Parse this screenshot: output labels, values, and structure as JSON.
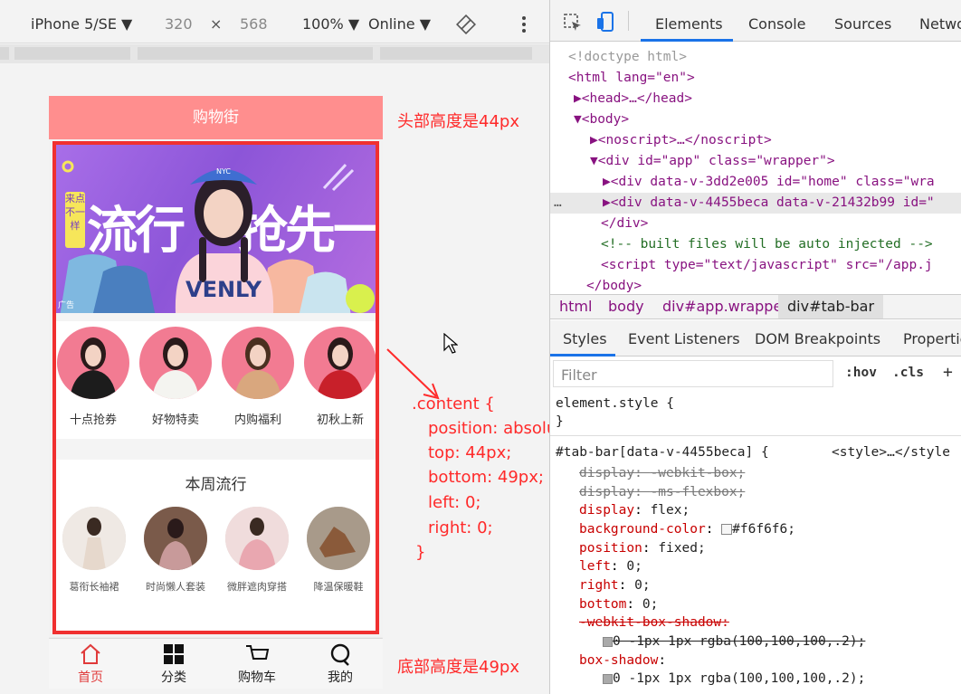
{
  "device_toolbar": {
    "device": "iPhone 5/SE ▼",
    "width": "320",
    "times": "×",
    "height": "568",
    "zoom": "100% ▼",
    "network": "Online ▼"
  },
  "phone": {
    "header_title": "购物街",
    "banner": {
      "tag": "来点不一样",
      "text_left": "流行",
      "text_right": "抢先一步",
      "ad_label": "广告",
      "cap_text": "NYC",
      "shirt_text": "VENLY"
    },
    "hot_items": [
      "十点抢券",
      "好物特卖",
      "内购福利",
      "初秋上新"
    ],
    "weekly_title": "本周流行",
    "weekly_items": [
      "葛衔长袖裙",
      "时尚懒人套装",
      "微胖遮肉穿搭",
      "降温保暖鞋"
    ],
    "tabs": [
      {
        "label": "首页",
        "active": true
      },
      {
        "label": "分类",
        "active": false
      },
      {
        "label": "购物车",
        "active": false
      },
      {
        "label": "我的",
        "active": false
      }
    ]
  },
  "annotations": {
    "header_note": "头部高度是44px",
    "css_lines": [
      ".content {",
      "position: absolute;",
      "top: 44px;",
      "bottom: 49px;",
      "left: 0;",
      "right: 0;",
      "}"
    ],
    "footer_note": "底部高度是49px"
  },
  "devtools": {
    "tabs": [
      "Elements",
      "Console",
      "Sources",
      "Netwo"
    ],
    "html_lines": [
      "<!doctype html>",
      "<html lang=\"en\">",
      "▶<head>…</head>",
      "▼<body>",
      "▶<noscript>…</noscript>",
      "▼<div id=\"app\" class=\"wrapper\">",
      "▶<div data-v-3dd2e005 id=\"home\" class=\"wra",
      "▶<div data-v-4455beca data-v-21432b99 id=\"",
      "</div>",
      "<!-- built files will be auto injected -->",
      "<script type=\"text/javascript\" src=\"/app.j",
      "</body>"
    ],
    "breadcrumbs": [
      "html",
      "body",
      "div#app.wrapper",
      "div#tab-bar"
    ],
    "style_tabs": [
      "Styles",
      "Event Listeners",
      "DOM Breakpoints",
      "Propertie"
    ],
    "filter_placeholder": "Filter",
    "filter_hov": ":hov",
    "filter_cls": ".cls",
    "filter_plus": "+",
    "element_style": "element.style {",
    "element_style_close": "}",
    "rule_selector": "#tab-bar[data-v-4455beca] {",
    "rule_source": "<style>…</style",
    "declarations": [
      {
        "prop": "display",
        "value": "-webkit-box;",
        "struck": true
      },
      {
        "prop": "display",
        "value": "-ms-flexbox;",
        "struck": true
      },
      {
        "prop": "display",
        "value": "flex;",
        "struck": false
      },
      {
        "prop": "background-color",
        "value": "#f6f6f6;",
        "struck": false
      },
      {
        "prop": "position",
        "value": "fixed;",
        "struck": false
      },
      {
        "prop": "left",
        "value": "0;",
        "struck": false
      },
      {
        "prop": "right",
        "value": "0;",
        "struck": false
      },
      {
        "prop": "bottom",
        "value": "0;",
        "struck": false
      },
      {
        "prop": "-webkit-box-shadow",
        "value": "",
        "struck": true
      },
      {
        "prop": "",
        "value": "0 -1px 1px rgba(100,100,100,.2);",
        "struck": true
      },
      {
        "prop": "box-shadow",
        "value": "",
        "struck": false
      },
      {
        "prop": "",
        "value": "0 -1px 1px rgba(100,100,100,.2);",
        "struck": false
      }
    ]
  },
  "colors": {
    "header_pink": "#ff8e8e",
    "content_border": "#f03030",
    "active_tab": "#e03a3a",
    "annotation_red": "#ff2a2a"
  }
}
